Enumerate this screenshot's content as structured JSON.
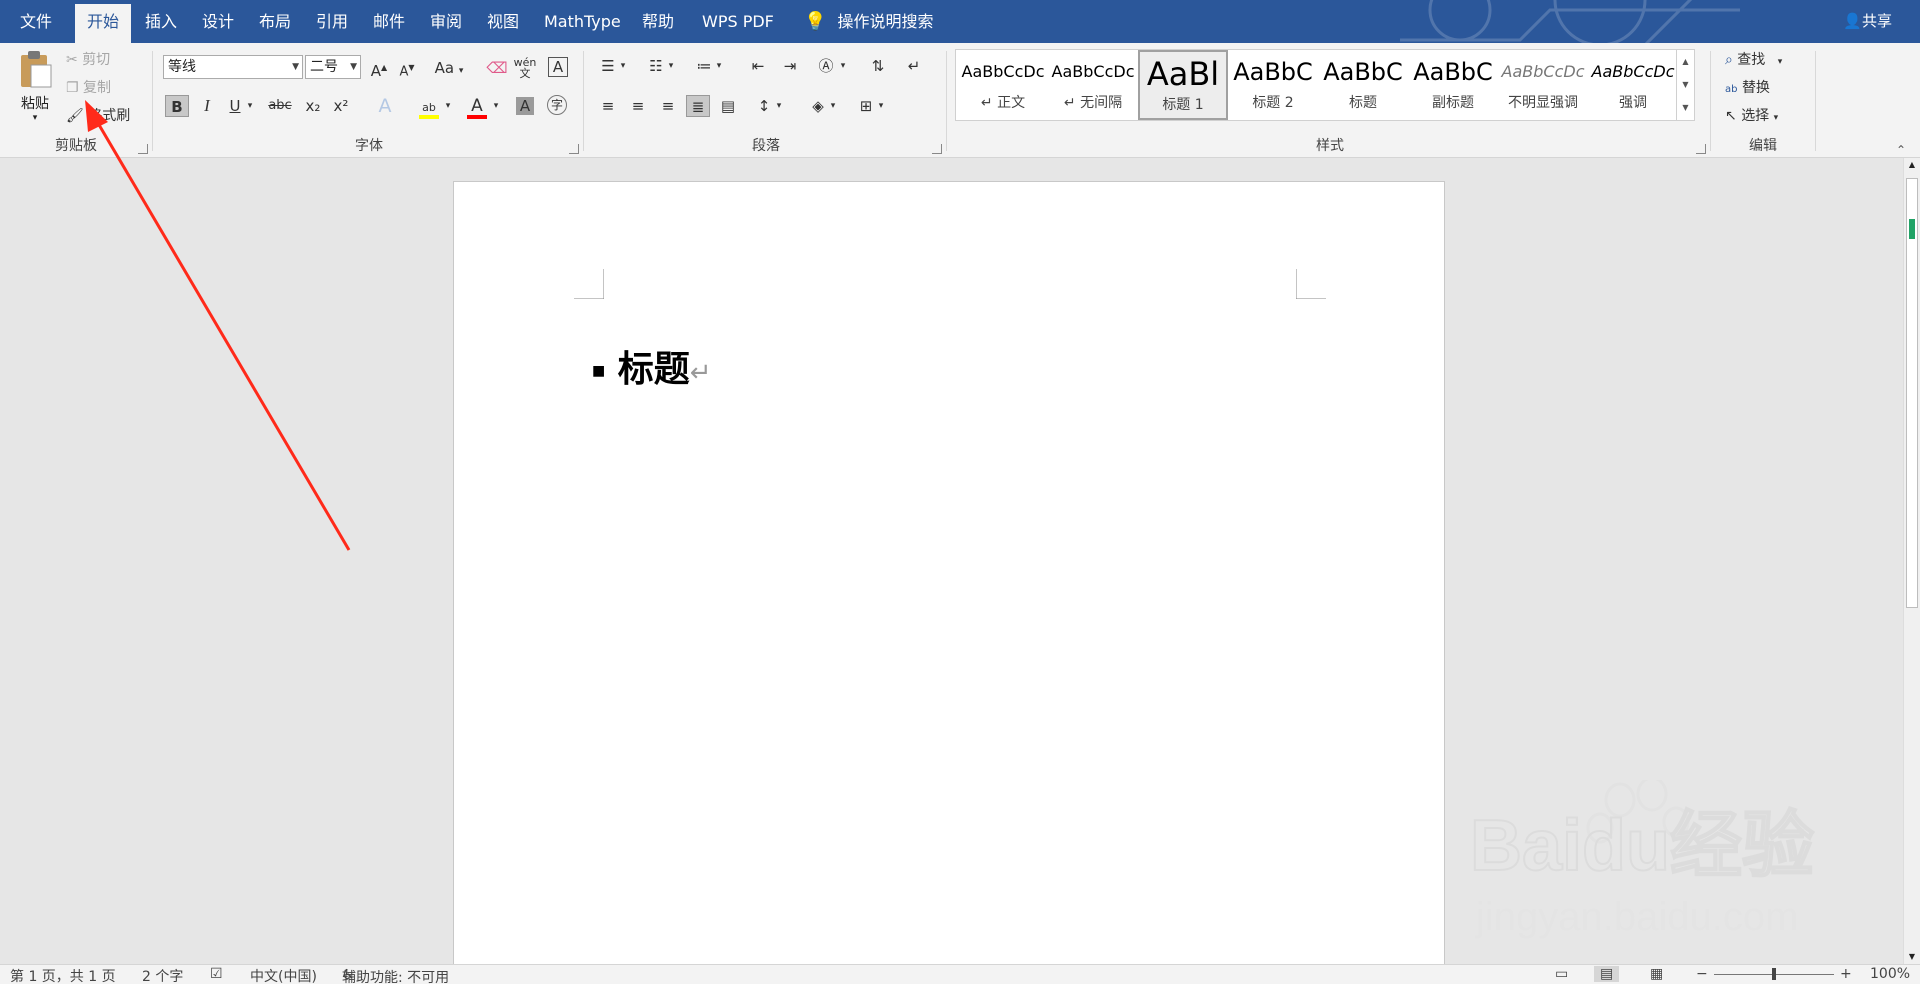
{
  "tabs": {
    "file": "文件",
    "home": "开始",
    "insert": "插入",
    "design": "设计",
    "layout": "布局",
    "references": "引用",
    "mailings": "邮件",
    "review": "审阅",
    "view": "视图",
    "mathtype": "MathType",
    "help": "帮助",
    "wpspdf": "WPS PDF",
    "tellme": "操作说明搜索",
    "share": "共享"
  },
  "clipboard": {
    "paste": "粘贴",
    "cut": "剪切",
    "copy": "复制",
    "format_painter": "格式刷",
    "label": "剪贴板"
  },
  "font": {
    "name": "等线",
    "size": "二号",
    "change_case": "Aa",
    "bold": "B",
    "italic": "I",
    "underline": "U",
    "strike": "abc",
    "sub": "x₂",
    "sup": "x²",
    "label": "字体"
  },
  "paragraph": {
    "label": "段落"
  },
  "styles": {
    "label": "样式",
    "items": [
      {
        "preview": "AaBbCcDc",
        "name": "↵ 正文"
      },
      {
        "preview": "AaBbCcDc",
        "name": "↵ 无间隔"
      },
      {
        "preview": "AaBl",
        "name": "标题 1"
      },
      {
        "preview": "AaBbC",
        "name": "标题 2"
      },
      {
        "preview": "AaBbC",
        "name": "标题"
      },
      {
        "preview": "AaBbC",
        "name": "副标题"
      },
      {
        "preview": "AaBbCcDc",
        "name": "不明显强调"
      },
      {
        "preview": "AaBbCcDc",
        "name": "强调"
      }
    ]
  },
  "editing": {
    "find": "查找",
    "replace": "替换",
    "select": "选择",
    "label": "编辑"
  },
  "document": {
    "heading": "标题",
    "pilcrow": "↵"
  },
  "status": {
    "page": "第 1 页，共 1 页",
    "words": "2 个字",
    "language": "中文(中国)",
    "accessibility": "辅助功能: 不可用",
    "zoom": "100%"
  },
  "watermark": {
    "brand": "Baidu经验",
    "url": "jingyan.baidu.com"
  },
  "colors": {
    "title_bar": "#2b579a",
    "ribbon": "#f3f3f3",
    "annotation_arrow": "#ff2a1a",
    "font_color": "#ff0000",
    "highlight": "#ffff00"
  }
}
